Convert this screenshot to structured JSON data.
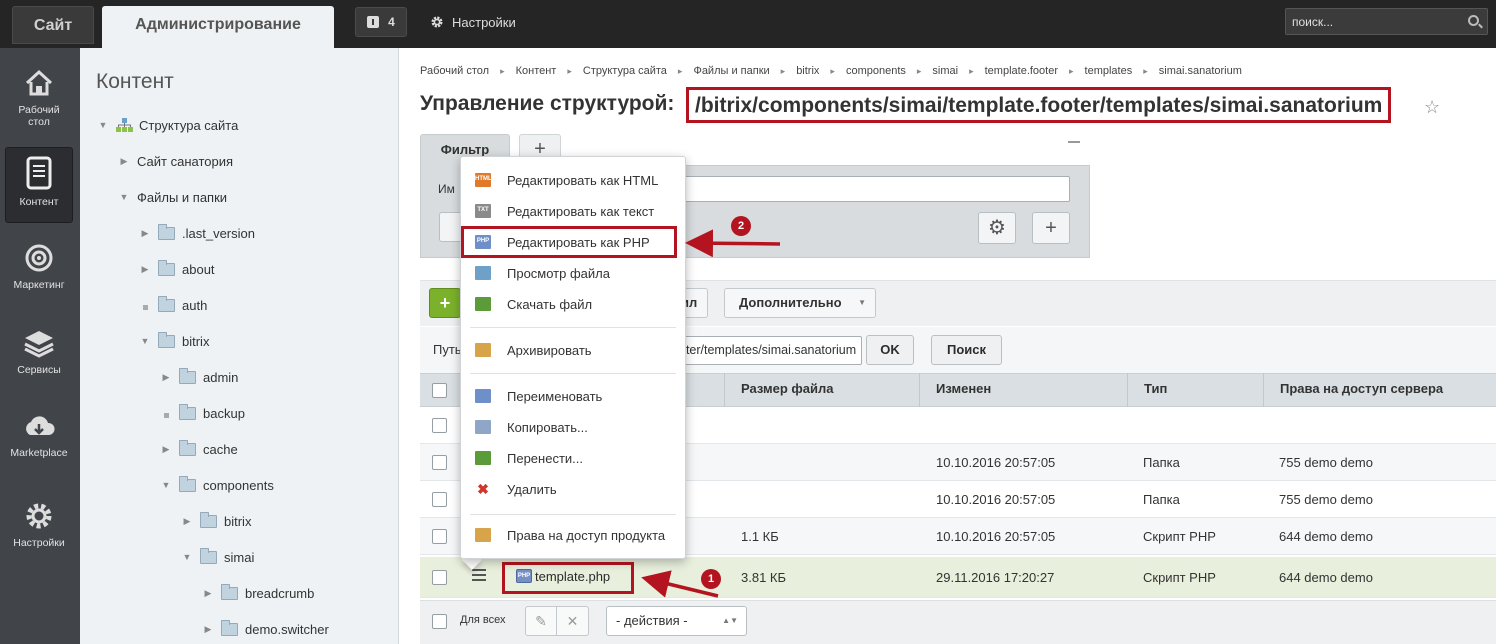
{
  "topbar": {
    "site_tab": "Сайт",
    "admin_tab": "Администрирование",
    "notifications_count": "4",
    "settings_label": "Настройки",
    "search_placeholder": "поиск..."
  },
  "left_menu": [
    {
      "label": "Рабочий\nстол",
      "icon": "home-icon"
    },
    {
      "label": "Контент",
      "icon": "document-icon",
      "active": true
    },
    {
      "label": "Маркетинг",
      "icon": "target-icon"
    },
    {
      "label": "Сервисы",
      "icon": "layers-icon"
    },
    {
      "label": "Marketplace",
      "icon": "cloud-download-icon"
    },
    {
      "label": "Настройки",
      "icon": "gear-icon"
    }
  ],
  "tree": {
    "title": "Контент",
    "items": [
      {
        "label": "Структура сайта",
        "toggle": "open",
        "icon": "site-structure-icon"
      },
      {
        "label": "Сайт санатория",
        "toggle": "closed",
        "icon": "none"
      },
      {
        "label": "Файлы и папки",
        "toggle": "open",
        "icon": "none"
      },
      {
        "label": ".last_version",
        "toggle": "closed",
        "icon": "folder-icon"
      },
      {
        "label": "about",
        "toggle": "closed",
        "icon": "folder-icon"
      },
      {
        "label": "auth",
        "toggle": "leaf",
        "icon": "folder-icon"
      },
      {
        "label": "bitrix",
        "toggle": "open",
        "icon": "folder-icon"
      },
      {
        "label": "admin",
        "toggle": "closed",
        "icon": "folder-icon"
      },
      {
        "label": "backup",
        "toggle": "leaf",
        "icon": "folder-icon"
      },
      {
        "label": "cache",
        "toggle": "closed",
        "icon": "folder-icon"
      },
      {
        "label": "components",
        "toggle": "open",
        "icon": "folder-icon"
      },
      {
        "label": "bitrix",
        "toggle": "closed",
        "icon": "folder-icon"
      },
      {
        "label": "simai",
        "toggle": "open",
        "icon": "folder-icon"
      },
      {
        "label": "breadcrumb",
        "toggle": "closed",
        "icon": "folder-icon"
      },
      {
        "label": "demo.switcher",
        "toggle": "closed",
        "icon": "folder-icon"
      }
    ]
  },
  "breadcrumbs": [
    "Рабочий стол",
    "Контент",
    "Структура сайта",
    "Файлы и папки",
    "bitrix",
    "components",
    "simai",
    "template.footer",
    "templates",
    "simai.sanatorium"
  ],
  "page": {
    "title_prefix": "Управление структурой:",
    "title_path": "/bitrix/components/simai/template.footer/templates/simai.sanatorium"
  },
  "filter": {
    "tab_label": "Фильтр",
    "add_label": "+",
    "name_label": "Им",
    "settings_label": "⚙",
    "plus_label": "+"
  },
  "toolbar": {
    "add_label": "+",
    "hidden_label": "ил",
    "more_label": "Дополнительно",
    "path_label": "Путь",
    "path_value": "oter/templates/simai.sanatorium",
    "ok_label": "OK",
    "search_label": "Поиск"
  },
  "table": {
    "columns": [
      "Размер файла",
      "Изменен",
      "Тип",
      "Права на доступ сервера"
    ],
    "rows": [
      {
        "size": "",
        "modified": "",
        "type": "",
        "rights": ""
      },
      {
        "size": "",
        "modified": "10.10.2016 20:57:05",
        "type": "Папка",
        "rights": "755 demo demo"
      },
      {
        "size": "",
        "modified": "10.10.2016 20:57:05",
        "type": "Папка",
        "rights": "755 demo demo"
      },
      {
        "size": "1.1 КБ",
        "modified": "10.10.2016 20:57:05",
        "type": "Скрипт PHP",
        "rights": "644 demo demo"
      },
      {
        "size": "3.81 КБ",
        "modified": "29.11.2016 17:20:27",
        "type": "Скрипт PHP",
        "rights": "644 demo demo",
        "name": "template.php"
      }
    ],
    "footer": {
      "for_all": "Для всех",
      "actions_placeholder": "- действия -"
    }
  },
  "context_menu": [
    {
      "label": "Редактировать как HTML",
      "icon": "html-file-icon",
      "color": "#e07a2a"
    },
    {
      "label": "Редактировать как текст",
      "icon": "txt-file-icon",
      "color": "#8a8a8a"
    },
    {
      "label": "Редактировать как PHP",
      "icon": "php-file-icon",
      "color": "#6f8fc8"
    },
    {
      "label": "Просмотр файла",
      "icon": "view-file-icon",
      "color": "#6fa0c8"
    },
    {
      "label": "Скачать файл",
      "icon": "download-file-icon",
      "color": "#5c9b3a"
    },
    {
      "label": "Архивировать",
      "icon": "archive-icon",
      "color": "#d7a44a"
    },
    {
      "label": "Переименовать",
      "icon": "rename-icon",
      "color": "#6f8fc8"
    },
    {
      "label": "Копировать...",
      "icon": "copy-icon",
      "color": "#8fa6c6"
    },
    {
      "label": "Перенести...",
      "icon": "move-icon",
      "color": "#5c9b3a"
    },
    {
      "label": "Удалить",
      "icon": "delete-icon",
      "color": "#d0362a"
    },
    {
      "label": "Права на доступ продукта",
      "icon": "user-rights-icon",
      "color": "#d7a44a"
    }
  ],
  "annotations": {
    "badge1": "1",
    "badge2": "2",
    "highlight_color": "#b3141f"
  }
}
